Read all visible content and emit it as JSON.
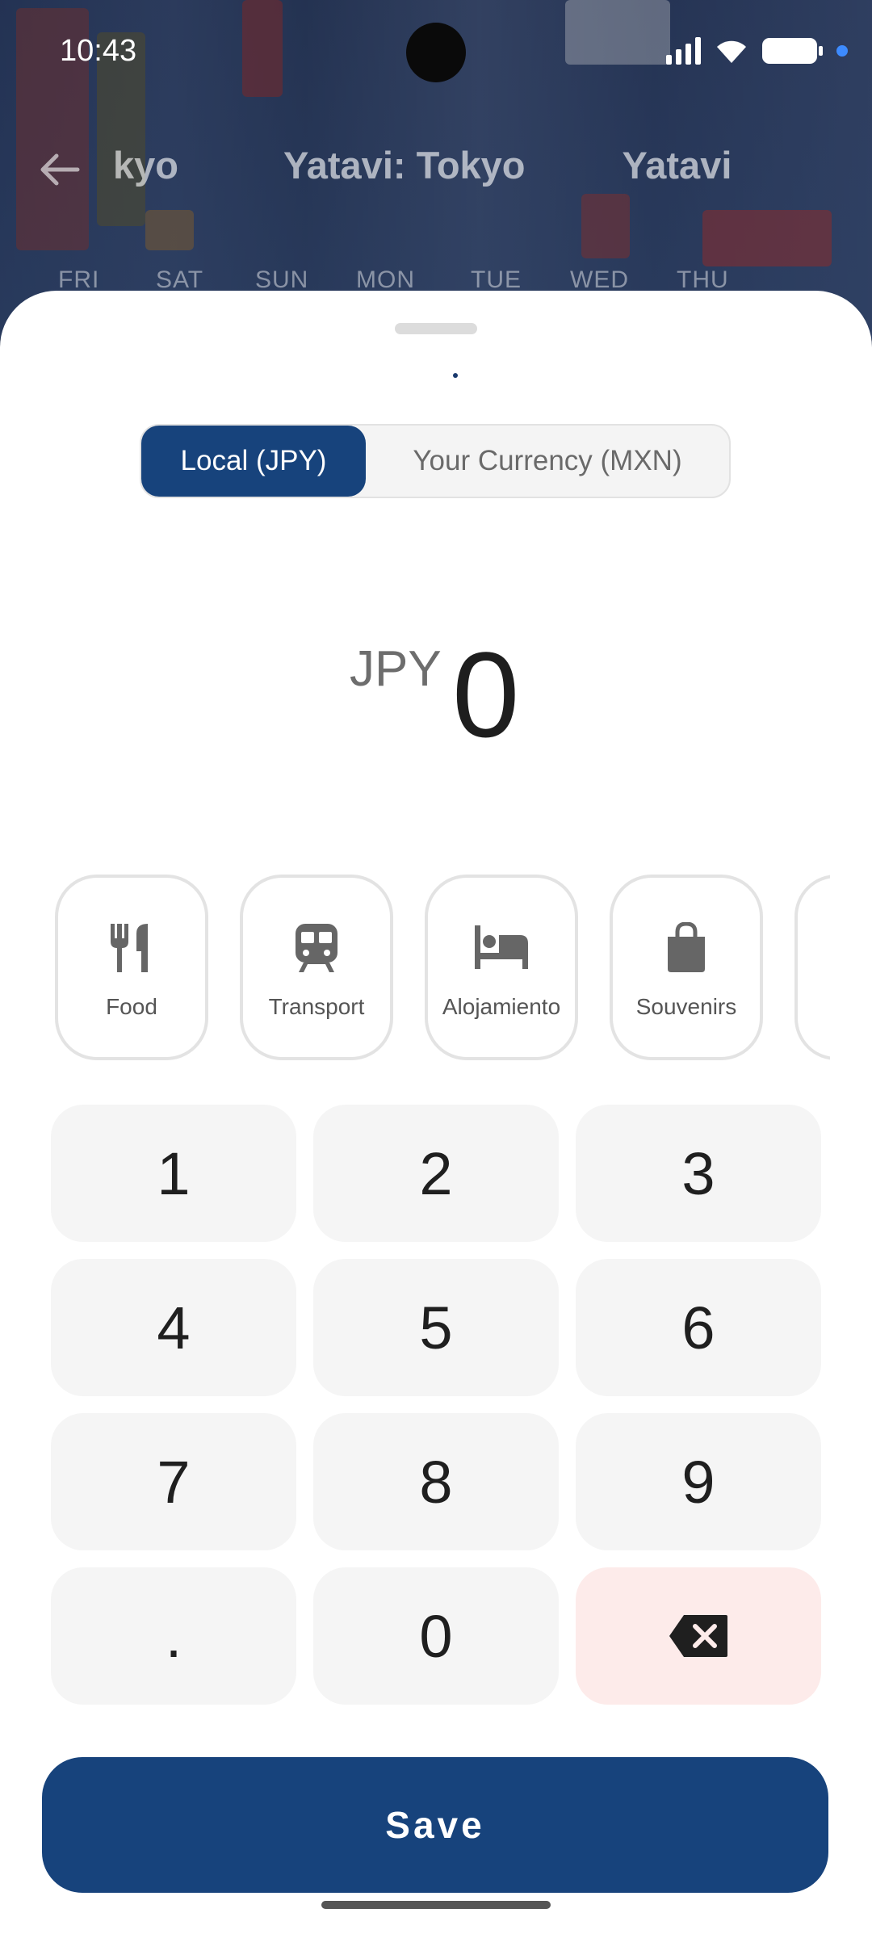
{
  "status": {
    "time": "10:43"
  },
  "header": {
    "titles": [
      "kyo",
      "Yatavi: Tokyo",
      "Yatavi"
    ],
    "days": [
      "FRI",
      "SAT",
      "SUN",
      "MON",
      "TUE",
      "WED",
      "THU"
    ]
  },
  "toggle": {
    "local_label": "Local (JPY)",
    "foreign_label": "Your Currency (MXN)",
    "active": "local"
  },
  "amount": {
    "currency": "JPY",
    "value": "0"
  },
  "categories": [
    {
      "label": "Food",
      "icon": "fork-knife-icon"
    },
    {
      "label": "Transport",
      "icon": "train-icon"
    },
    {
      "label": "Alojamiento",
      "icon": "bed-icon"
    },
    {
      "label": "Souvenirs",
      "icon": "shopping-bag-icon"
    }
  ],
  "keypad": {
    "keys": [
      "1",
      "2",
      "3",
      "4",
      "5",
      "6",
      "7",
      "8",
      "9",
      ".",
      "0"
    ],
    "delete_icon": "backspace-icon"
  },
  "save_label": "Save",
  "colors": {
    "primary": "#17437c",
    "delete_bg": "#fdebea",
    "key_bg": "#f5f5f5"
  }
}
